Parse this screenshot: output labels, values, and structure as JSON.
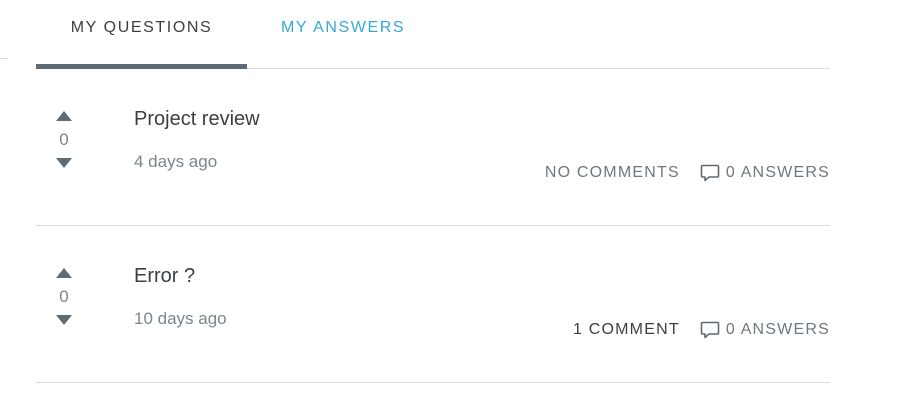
{
  "tabs": [
    {
      "label": "MY QUESTIONS",
      "active": true
    },
    {
      "label": "MY ANSWERS",
      "active": false
    }
  ],
  "questions": [
    {
      "title": "Project review",
      "time": "4 days ago",
      "votes": "0",
      "comments": "NO COMMENTS",
      "answers": "0 ANSWERS"
    },
    {
      "title": "Error ?",
      "time": "10 days ago",
      "votes": "0",
      "comments": "1 COMMENT",
      "answers": "0 ANSWERS"
    }
  ],
  "icons": {
    "vote_up": "triangle-up-icon",
    "vote_down": "triangle-down-icon",
    "answers": "speech-bubble-icon"
  },
  "colors": {
    "active_tab_text": "#3a3f44",
    "inactive_tab_text": "#35a9d4",
    "active_tab_underline": "#5f6b74",
    "divider": "#d9dde0"
  }
}
